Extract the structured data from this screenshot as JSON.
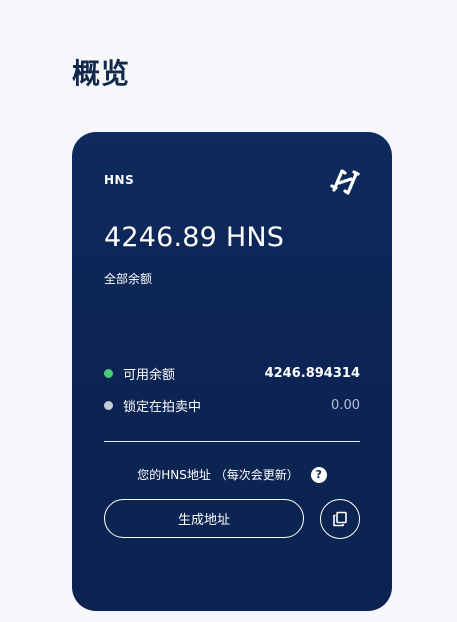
{
  "page": {
    "title": "概览"
  },
  "wallet": {
    "ticker": "HNS",
    "logo_icon": "handshake-logo-icon",
    "total_balance": "4246.89 HNS",
    "total_balance_label": "全部余额",
    "available": {
      "label": "可用余额",
      "value": "4246.894314",
      "dot_color": "#4cc87a"
    },
    "locked": {
      "label": "锁定在拍卖中",
      "value": "0.00",
      "dot_color": "#c7ccd6"
    },
    "address_hint": "您的HNS地址 （每次会更新）",
    "help_icon": "question-icon",
    "help_glyph": "?",
    "generate_button": "生成地址",
    "copy_icon": "copy-icon"
  },
  "colors": {
    "card_bg": "#0c2554",
    "page_bg": "#f5f7fa",
    "title": "#13294b"
  }
}
